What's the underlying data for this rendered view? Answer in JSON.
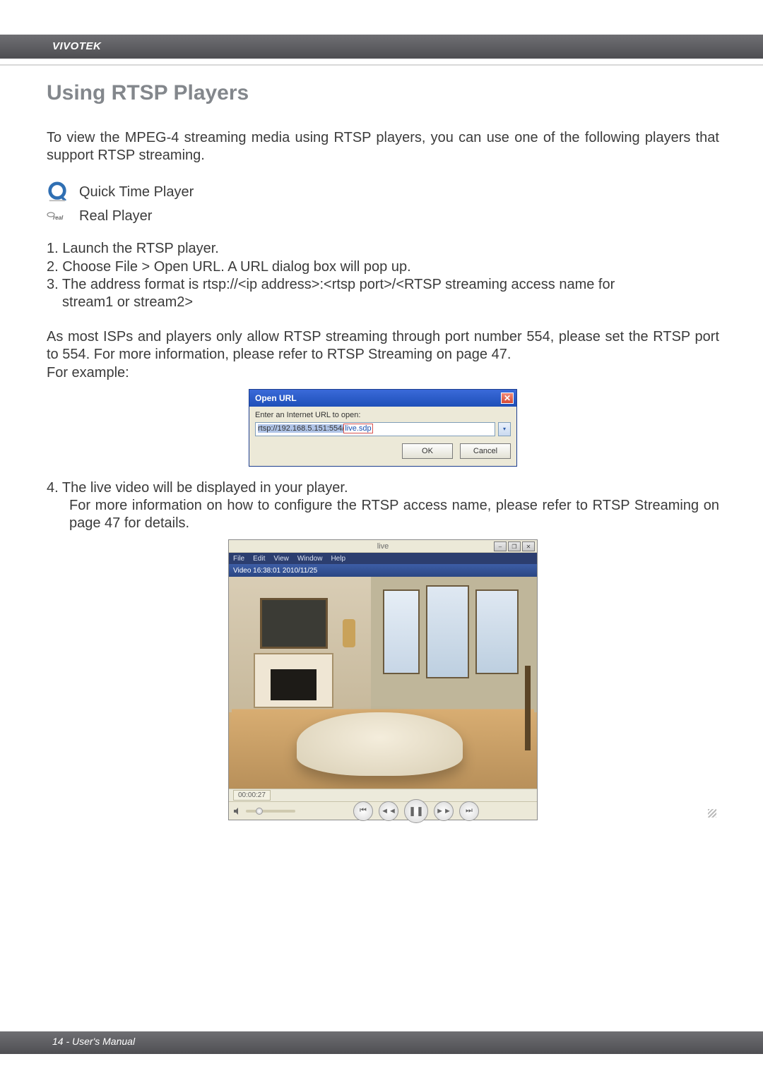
{
  "header": {
    "brand": "VIVOTEK"
  },
  "title": "Using RTSP Players",
  "intro": "To view the MPEG-4 streaming media using RTSP players, you can use one of the following players that support RTSP streaming.",
  "players": {
    "qt": "Quick Time Player",
    "real": "Real Player",
    "real_icon_text": "real"
  },
  "steps": {
    "s1": "1. Launch the RTSP player.",
    "s2": "2. Choose File > Open URL. A URL dialog box will pop up.",
    "s3a": "3. The address format is rtsp://<ip address>:<rtsp port>/<RTSP streaming access name for",
    "s3b": "stream1 or stream2>"
  },
  "note": {
    "l1": "As most ISPs and players only allow RTSP streaming through port number 554, please set the RTSP port to 554. For more information, please refer to RTSP Streaming on page 47.",
    "l2": "For example:"
  },
  "dialog": {
    "title": "Open URL",
    "label": "Enter an Internet URL to open:",
    "url_prefix": "rtsp://192.168.5.151:554/",
    "url_suffix": "live.sdp",
    "ok": "OK",
    "cancel": "Cancel",
    "close": "✕",
    "chevron": "▾"
  },
  "step4": {
    "l1": "4. The live video will be displayed in your player.",
    "l2": "For more information on how to configure the RTSP access name, please refer to RTSP Streaming on page 47 for details."
  },
  "player": {
    "title": "live",
    "menu": {
      "file": "File",
      "edit": "Edit",
      "view": "View",
      "window": "Window",
      "help": "Help"
    },
    "overlay": "Video 16:38:01 2010/11/25",
    "elapsed": "00:00:27",
    "win": {
      "min": "–",
      "max": "❐",
      "close": "✕"
    },
    "ctrl": {
      "prev": "⏮",
      "rew": "◄◄",
      "pause": "❚❚",
      "fwd": "►►",
      "next": "⏭"
    }
  },
  "footer": {
    "text": "14 - User's Manual"
  }
}
